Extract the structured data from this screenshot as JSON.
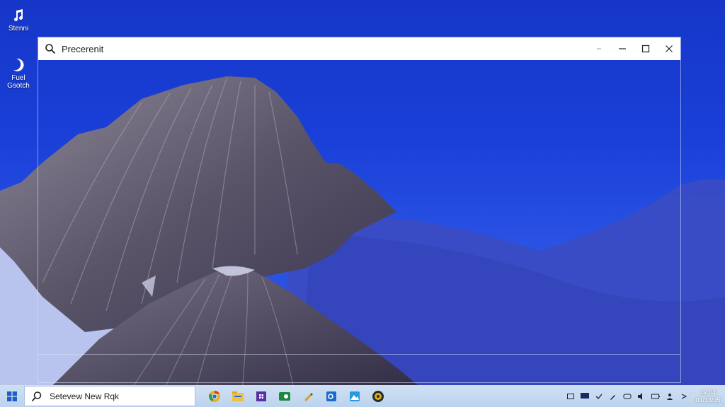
{
  "desktop": {
    "icons": [
      {
        "label": "Stenni",
        "icon": "music-note-icon"
      },
      {
        "label": "Fuel\nGsotch",
        "icon": "crescent-icon"
      }
    ]
  },
  "window": {
    "search_text": "Precerenit",
    "controls": [
      "minimize-dash",
      "minimize",
      "maximize",
      "close"
    ]
  },
  "taskbar": {
    "search_text": "Setevew New Rqk",
    "apps": [
      "chrome-icon",
      "file-explorer-icon",
      "store-icon",
      "xbox-icon",
      "pen-icon",
      "outlook-icon",
      "photos-icon",
      "settings-icon"
    ],
    "tray_icons": [
      "tray-window-icon",
      "tray-monitor-icon",
      "tray-check-icon",
      "tray-pen-icon",
      "tray-network-icon",
      "tray-volume-icon",
      "tray-battery-icon",
      "tray-person-icon",
      "tray-chevron-icon"
    ],
    "clock": {
      "time": "12:04",
      "date": "01/33/35"
    }
  },
  "colors": {
    "sky_top": "#1636c8",
    "sky_bottom": "#2f4fd0",
    "taskbar": "#c7dbf1",
    "titlebar": "#ffffff"
  }
}
